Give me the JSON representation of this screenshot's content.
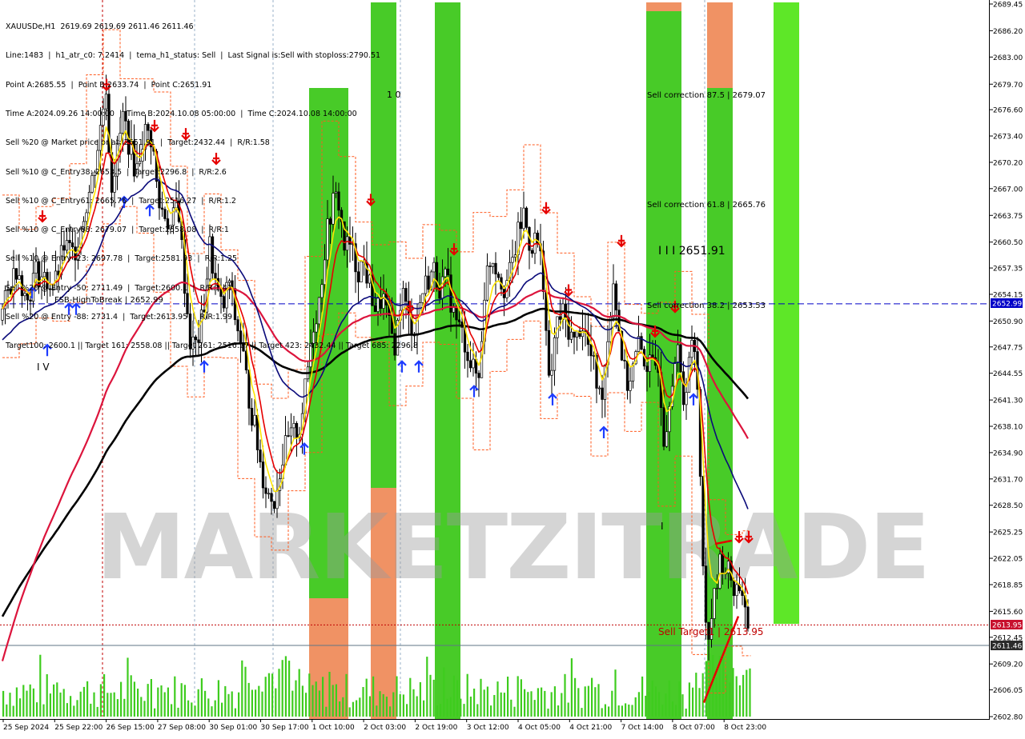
{
  "header": {
    "lines": [
      "XAUUSDe,H1  2619.69 2619.69 2611.46 2611.46",
      "Line:1483  |  h1_atr_c0: 7.2414  |  tema_h1_status: Sell  |  Last Signal is:Sell with stoploss:2790.51",
      "Point A:2685.55  |  Point B:2633.74  |  Point C:2651.91",
      "Time A:2024.09.26 14:00:00  |  Time B:2024.10.08 05:00:00  |  Time C:2024.10.08 14:00:00",
      "Sell %20 @ Market price or at: 2651.91  |  Target:2432.44  |  R/R:1.58",
      "Sell %10 @ C_Entry38: 2653.5  |  Target:2296.8  |  R/R:2.6",
      "Sell %10 @ C_Entry61: 2665.76  |  Target:2516.27  |  R/R:1.2",
      "Sell %10 @ C_Entry88: 2679.07  |  Target:2558.08  |  R/R:1",
      "Sell %10 @ Entry -23: 2697.78  |  Target:2581.93  |  R/R:1.25",
      "Sell %20 @ Entry -50: 2711.49  |  Target:2600.1  |  R/R:1.41",
      "Sell %20 @ Entry -88: 2731.4  |  Target:2613.95  |  R/R:1.99",
      "Target100: 2600.1 || Target 161: 2558.08 || Target 261: 2516.27 || Target 423: 2432.44 || Target 685: 2296.8"
    ]
  },
  "watermark": "MARKETZITRADE",
  "annotations": {
    "fsb": "FSB-HighToBreak | 2652.99",
    "point_c": "I I I 2651.91",
    "sell_c875": "Sell correction 87.5 | 2679.07",
    "sell_c618": "Sell correction 61.8 | 2665.76",
    "sell_c382": "Sell correction 38.2 | 2653.53",
    "sell_target": "Sell Target1 | 2613.95",
    "label_10": "1 0",
    "label_iv": "I V",
    "label_i": "I"
  },
  "price_tags": {
    "current": "2611.46",
    "fsb": "2652.99",
    "target": "2613.95"
  },
  "chart_data": {
    "type": "candlestick",
    "symbol": "XAUUSDe",
    "timeframe": "H1",
    "ylim": [
      2602.8,
      2689.45
    ],
    "y_ticks": [
      2689.45,
      2686.2,
      2683.0,
      2679.7,
      2676.6,
      2673.4,
      2670.2,
      2667.0,
      2663.75,
      2660.5,
      2657.35,
      2654.15,
      2650.9,
      2647.75,
      2644.55,
      2641.3,
      2638.1,
      2634.9,
      2631.7,
      2628.5,
      2625.25,
      2622.05,
      2618.85,
      2615.6,
      2612.45,
      2609.2,
      2606.05,
      2602.8
    ],
    "x_ticks": [
      "25 Sep 2024",
      "25 Sep 22:00",
      "26 Sep 15:00",
      "27 Sep 08:00",
      "30 Sep 01:00",
      "30 Sep 17:00",
      "1 Oct 10:00",
      "2 Oct 03:00",
      "2 Oct 19:00",
      "3 Oct 12:00",
      "4 Oct 05:00",
      "4 Oct 21:00",
      "7 Oct 14:00",
      "8 Oct 07:00",
      "8 Oct 23:00"
    ],
    "levels": [
      {
        "name": "FSB-HighToBreak",
        "value": 2652.99,
        "color": "#0000c8"
      },
      {
        "name": "Sell Target1",
        "value": 2613.95,
        "color": "#c00000"
      },
      {
        "name": "Last price",
        "value": 2611.46,
        "color": "#5f7586"
      }
    ],
    "points": {
      "A": 2685.55,
      "B": 2633.74,
      "C": 2651.91
    },
    "series_keys": [
      {
        "color": "#000000"
      },
      {
        "color": "#dc143c"
      },
      {
        "color": "#0a0a7a"
      },
      {
        "color": "#e60000"
      },
      {
        "color": "#ffe500"
      }
    ],
    "close_path": [
      [
        0,
        2651
      ],
      [
        12,
        2655
      ],
      [
        22,
        2658
      ],
      [
        33,
        2653
      ],
      [
        44,
        2657
      ],
      [
        55,
        2656
      ],
      [
        68,
        2655
      ],
      [
        80,
        2660
      ],
      [
        92,
        2659
      ],
      [
        105,
        2664
      ],
      [
        115,
        2668
      ],
      [
        125,
        2674
      ],
      [
        133,
        2680
      ],
      [
        138,
        2667
      ],
      [
        146,
        2671
      ],
      [
        154,
        2676
      ],
      [
        162,
        2672
      ],
      [
        170,
        2669
      ],
      [
        180,
        2674
      ],
      [
        190,
        2673
      ],
      [
        198,
        2665
      ],
      [
        206,
        2664
      ],
      [
        214,
        2662
      ],
      [
        222,
        2666
      ],
      [
        230,
        2656
      ],
      [
        238,
        2648
      ],
      [
        246,
        2648
      ],
      [
        254,
        2652
      ],
      [
        262,
        2660
      ],
      [
        270,
        2655
      ],
      [
        278,
        2652
      ],
      [
        286,
        2656
      ],
      [
        294,
        2651
      ],
      [
        302,
        2648
      ],
      [
        310,
        2642
      ],
      [
        318,
        2638
      ],
      [
        326,
        2633
      ],
      [
        334,
        2630
      ],
      [
        342,
        2629
      ],
      [
        350,
        2633
      ],
      [
        358,
        2636
      ],
      [
        366,
        2637
      ],
      [
        374,
        2638
      ],
      [
        382,
        2643
      ],
      [
        390,
        2650
      ],
      [
        398,
        2653
      ],
      [
        406,
        2660
      ],
      [
        414,
        2665
      ],
      [
        422,
        2666
      ],
      [
        430,
        2660
      ],
      [
        438,
        2660
      ],
      [
        446,
        2657
      ],
      [
        454,
        2658
      ],
      [
        462,
        2655
      ],
      [
        470,
        2652
      ],
      [
        478,
        2654
      ],
      [
        486,
        2650
      ],
      [
        494,
        2648
      ],
      [
        502,
        2655
      ],
      [
        510,
        2651
      ],
      [
        518,
        2650
      ],
      [
        526,
        2654
      ],
      [
        534,
        2656
      ],
      [
        542,
        2657
      ],
      [
        550,
        2655
      ],
      [
        558,
        2656
      ],
      [
        566,
        2652
      ],
      [
        574,
        2650
      ],
      [
        582,
        2648
      ],
      [
        590,
        2645
      ],
      [
        598,
        2644
      ],
      [
        606,
        2656
      ],
      [
        614,
        2659
      ],
      [
        622,
        2657
      ],
      [
        630,
        2655
      ],
      [
        638,
        2657
      ],
      [
        646,
        2661
      ],
      [
        654,
        2664
      ],
      [
        662,
        2660
      ],
      [
        670,
        2661
      ],
      [
        678,
        2657
      ],
      [
        686,
        2642
      ],
      [
        694,
        2650
      ],
      [
        702,
        2652
      ],
      [
        710,
        2650
      ],
      [
        718,
        2648
      ],
      [
        726,
        2651
      ],
      [
        734,
        2648
      ],
      [
        742,
        2645
      ],
      [
        750,
        2641
      ],
      [
        758,
        2648
      ],
      [
        766,
        2656
      ],
      [
        774,
        2649
      ],
      [
        782,
        2643
      ],
      [
        790,
        2645
      ],
      [
        798,
        2648
      ],
      [
        806,
        2646
      ],
      [
        814,
        2645
      ],
      [
        822,
        2646
      ],
      [
        830,
        2636
      ],
      [
        838,
        2644
      ],
      [
        846,
        2647
      ],
      [
        854,
        2641
      ],
      [
        862,
        2648
      ],
      [
        870,
        2646
      ],
      [
        876,
        2628
      ],
      [
        882,
        2612
      ],
      [
        888,
        2615
      ],
      [
        894,
        2618
      ],
      [
        900,
        2622
      ],
      [
        906,
        2621
      ],
      [
        912,
        2620
      ],
      [
        918,
        2618
      ],
      [
        924,
        2619
      ],
      [
        930,
        2617
      ],
      [
        935,
        2611.46
      ]
    ],
    "markers": {
      "sell_arrows": [
        [
          53,
          2663
        ],
        [
          133,
          2679
        ],
        [
          193,
          2674
        ],
        [
          232,
          2673
        ],
        [
          270,
          2670
        ],
        [
          463,
          2665
        ],
        [
          512,
          2652
        ],
        [
          567,
          2659
        ],
        [
          682,
          2664
        ],
        [
          710,
          2654
        ],
        [
          776,
          2660
        ],
        [
          818,
          2649
        ],
        [
          843,
          2652
        ],
        [
          923,
          2624
        ],
        [
          935,
          2624
        ]
      ],
      "buy_arrows": [
        [
          40,
          2655
        ],
        [
          59,
          2648
        ],
        [
          86,
          2653
        ],
        [
          95,
          2653
        ],
        [
          155,
          2666
        ],
        [
          187,
          2665
        ],
        [
          255,
          2646
        ],
        [
          380,
          2636
        ],
        [
          502,
          2646
        ],
        [
          523,
          2646
        ],
        [
          592,
          2643
        ],
        [
          690,
          2642
        ],
        [
          754,
          2638
        ],
        [
          866,
          2642
        ]
      ]
    }
  }
}
